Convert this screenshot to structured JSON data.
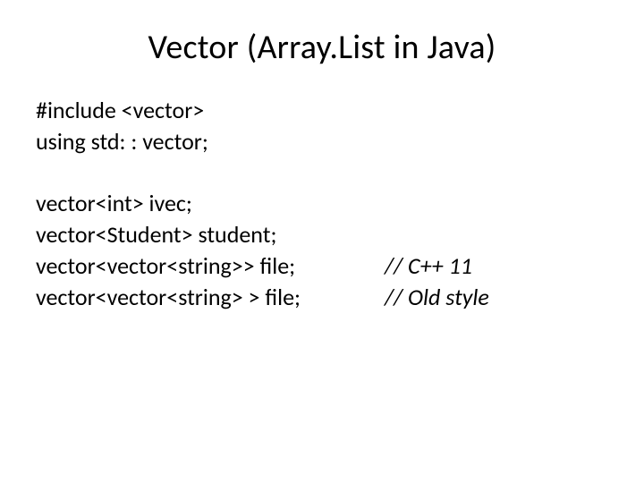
{
  "title": "Vector (Array.List in Java)",
  "block1": {
    "line1": "#include <vector>",
    "line2": "using std: : vector;"
  },
  "block2": {
    "line1": "vector<int> ivec;",
    "line2": "vector<Student> student;",
    "line3": "vector<vector<string>> file;",
    "line3_comment": "// C++ 11",
    "line4": "vector<vector<string> > file;",
    "line4_comment": "// Old style"
  }
}
